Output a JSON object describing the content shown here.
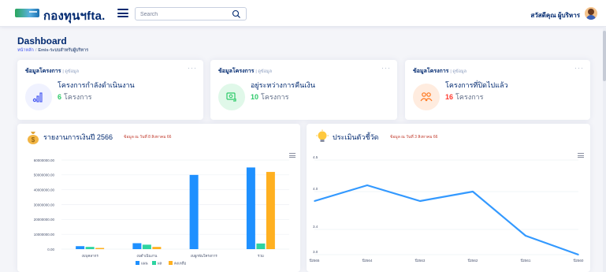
{
  "header": {
    "brand": "กองทุนฯfta.",
    "search_placeholder": "Search",
    "user_name": "สวัสดีคุณ ผู้บริหาร"
  },
  "page": {
    "title": "Dashboard",
    "breadcrumb": [
      "หน้าหลัก",
      "Emis-ระบบสำหรับผู้บริหาร"
    ]
  },
  "info_cards": [
    {
      "title": "ข้อมูลโครงการ",
      "subtitle": "| ดูข้อมูล",
      "label": "โครงการกำลังดำเนินงาน",
      "value": "6",
      "unit": "โครงการ",
      "icon": "chart-bars-icon",
      "value_color": "#2eca6a",
      "icon_bg": "#f0f2ff",
      "icon_color": "#4154f1"
    },
    {
      "title": "ข้อมูลโครงการ",
      "subtitle": "| ดูข้อมูล",
      "label": "อยู่ระหว่างการคืนเงิน",
      "value": "10",
      "unit": "โครงการ",
      "icon": "money-return-icon",
      "value_color": "#2eca6a",
      "icon_bg": "#e0f8e9",
      "icon_color": "#2eca6a"
    },
    {
      "title": "ข้อมูลโครงการ",
      "subtitle": "| ดูข้อมูล",
      "label": "โครงการที่ปิดไปแล้ว",
      "value": "16",
      "unit": "โครงการ",
      "icon": "people-icon",
      "value_color": "#ff3b30",
      "icon_bg": "#ffecdf",
      "icon_color": "#ff771d"
    }
  ],
  "finance_chart": {
    "title": "รายงานการเงินปี 2566",
    "subtitle": "ข้อมูล ณ วันที่ 8 สิงหาคม 66",
    "icon": "money-bag-icon"
  },
  "indicator_chart": {
    "title": "ประเมินตัวชี้วัด",
    "subtitle": "ข้อมูล ณ วันที่ 3 สิงหาคม 66",
    "icon": "lightbulb-icon"
  },
  "chart_data": [
    {
      "type": "bar",
      "categories": [
        "งบบุคลากร",
        "งบดำเนินงาน",
        "งบผูกพันโครงการ",
        "รวม"
      ],
      "series": [
        {
          "name": "แผน",
          "color": "#1e90ff",
          "values": [
            2000000,
            4000000,
            50000000,
            55000000
          ]
        },
        {
          "name": "ผล",
          "color": "#2ed4a0",
          "values": [
            1500000,
            3000000,
            0,
            3800000
          ]
        },
        {
          "name": "คงเหลือ",
          "color": "#ffb020",
          "values": [
            800000,
            1500000,
            0,
            52000000
          ]
        }
      ],
      "yticks": [
        "0.00",
        "10000000.00",
        "20000000.00",
        "30000000.00",
        "40000000.00",
        "50000000.00",
        "60000000.00"
      ],
      "ylim": [
        0,
        60000000
      ],
      "legend": "bottom"
    },
    {
      "type": "line",
      "categories": [
        "ปี2565",
        "ปี2564",
        "ปี2563",
        "ปี2562",
        "ปี2561",
        "ปี2560"
      ],
      "series": [
        {
          "color": "#3399ff",
          "values": [
            3.85,
            4.1,
            3.85,
            4.0,
            3.3,
            3.0
          ]
        }
      ],
      "yticks": [
        "3.0",
        "3.4",
        "4.0",
        "4.5"
      ],
      "ylim": [
        3.0,
        4.5
      ]
    }
  ]
}
